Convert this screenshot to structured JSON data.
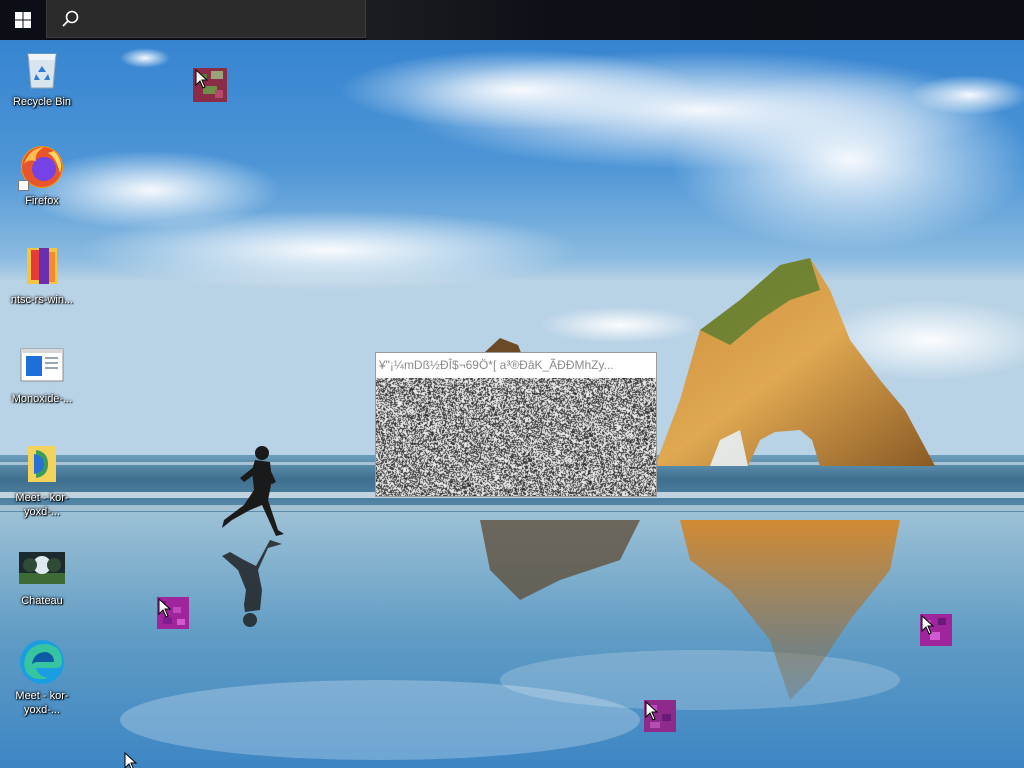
{
  "taskbar": {
    "start_icon": "windows-logo-icon",
    "search": {
      "icon": "search-icon",
      "value": "",
      "placeholder": ""
    }
  },
  "desktop": {
    "icons": [
      {
        "label": "Recycle Bin",
        "icon": "recycle-bin-icon"
      },
      {
        "label": "Firefox",
        "icon": "firefox-icon"
      },
      {
        "label": "ntsc-rs-win...",
        "icon": "ntsc-rs-icon"
      },
      {
        "label": "Monoxide-...",
        "icon": "monoxide-icon"
      },
      {
        "label": "Meet - kor-yoxd-...",
        "icon": "meet-icon"
      },
      {
        "label": "Chateau",
        "icon": "chateau-image-icon"
      },
      {
        "label": "Meet - kor-yoxd-...",
        "icon": "edge-icon"
      }
    ]
  },
  "glitch_window": {
    "title": "¥\"¡¼mDß½ÐÎ$¬69Ö*[  a³®ÐâK_ÃÐÐMhZy..."
  },
  "colors": {
    "taskbar_bg": "#0b0e14",
    "search_bg": "#2b2b2b",
    "glitch_magenta": "#a0249c"
  }
}
